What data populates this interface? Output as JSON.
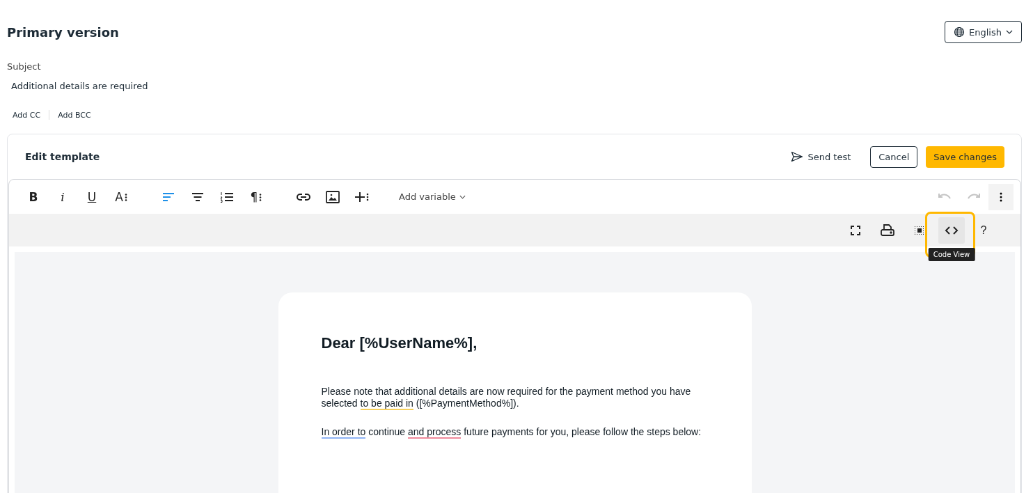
{
  "title": "Primary version",
  "language": {
    "label": "English"
  },
  "subject": {
    "label": "Subject",
    "value": "Additional details are required"
  },
  "recipient_links": [
    "Add CC",
    "Add BCC"
  ],
  "editor": {
    "title": "Edit template",
    "send_test": "Send test",
    "cancel": "Cancel",
    "save": "Save changes",
    "toolbar": [
      {
        "kind": "bold",
        "glyph": "B",
        "active": false
      },
      {
        "kind": "italic",
        "glyph": "i",
        "active": false
      },
      {
        "kind": "underline",
        "glyph": "U",
        "active": false
      },
      {
        "kind": "font-size",
        "glyph": "A",
        "active": false
      },
      {
        "kind": "align-left",
        "active": true
      },
      {
        "kind": "align-center",
        "active": false
      },
      {
        "kind": "ordered-list",
        "active": false
      },
      {
        "kind": "paragraph",
        "glyph": "¶",
        "active": false
      },
      {
        "kind": "link",
        "active": false
      },
      {
        "kind": "image",
        "active": false
      },
      {
        "kind": "insert",
        "active": false
      }
    ],
    "add_variable": "Add variable",
    "tools": [
      {
        "kind": "fullscreen",
        "hovered": false
      },
      {
        "kind": "print",
        "hovered": false
      },
      {
        "kind": "select-all",
        "hovered": false
      },
      {
        "kind": "code",
        "hovered": true,
        "tooltip": "Code View"
      },
      {
        "kind": "help",
        "glyph": "?",
        "hovered": false
      }
    ],
    "letter": {
      "heading": "Dear [%UserName%],",
      "paragraphs": [
        [
          {
            "text": "Please note that additional details are now required for the payment method you have selected "
          },
          {
            "text": "to be paid in",
            "color": "#f5cf5c"
          },
          {
            "text": " ([%PaymentMethod%])."
          }
        ],
        [
          {
            "text": "In order to",
            "color": "#8fb4f5"
          },
          {
            "text": " continue "
          },
          {
            "text": "and process",
            "color": "#f08a9c"
          },
          {
            "text": " future payments for you, please follow the steps below:"
          }
        ]
      ]
    }
  }
}
